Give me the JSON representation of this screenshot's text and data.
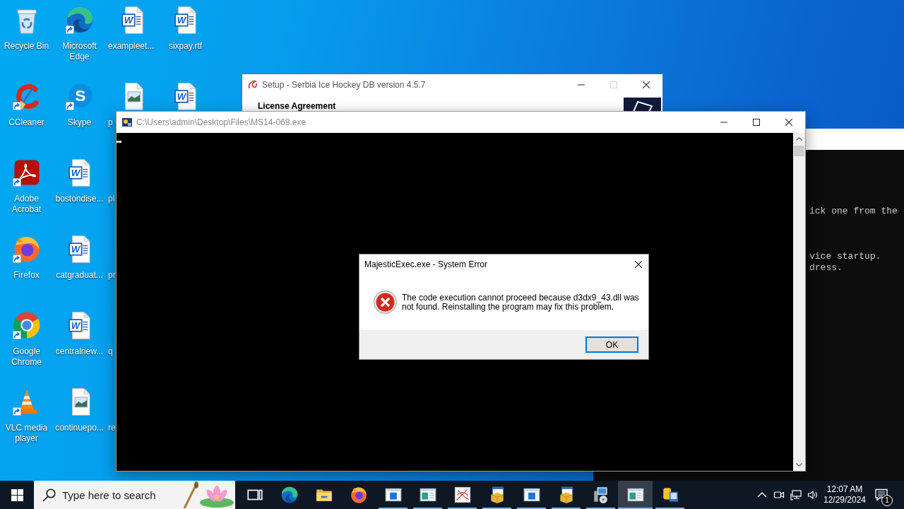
{
  "desktop": {
    "columns": [
      {
        "partly_hidden": false,
        "icons": [
          {
            "label": "Recycle Bin",
            "kind": "recycle-bin",
            "shortcut": false
          },
          {
            "label": "CCleaner",
            "kind": "ccleaner",
            "shortcut": true
          },
          {
            "label": "Adobe Acrobat",
            "kind": "acrobat",
            "shortcut": true
          },
          {
            "label": "Firefox",
            "kind": "firefox",
            "shortcut": true
          },
          {
            "label": "Google Chrome",
            "kind": "chrome",
            "shortcut": true
          },
          {
            "label": "VLC media player",
            "kind": "vlc",
            "shortcut": true
          }
        ]
      },
      {
        "partly_hidden": false,
        "icons": [
          {
            "label": "Microsoft Edge",
            "kind": "edge",
            "shortcut": true
          },
          {
            "label": "Skype",
            "kind": "skype",
            "glyph": "S",
            "shortcut": true
          },
          {
            "label": "bostondise...",
            "kind": "word",
            "glyph": "W",
            "shortcut": false
          },
          {
            "label": "catgraduat...",
            "kind": "word",
            "glyph": "W",
            "shortcut": false
          },
          {
            "label": "centralnew...",
            "kind": "word",
            "glyph": "W",
            "shortcut": false
          },
          {
            "label": "continuepo...",
            "kind": "image",
            "shortcut": false
          }
        ]
      },
      {
        "partly_hidden": true,
        "icons": [
          {
            "label": "exampleet...",
            "kind": "word",
            "glyph": "W",
            "shortcut": false
          },
          {
            "label": "p",
            "kind": "image",
            "shortcut": false
          },
          {
            "label": "pl",
            "kind": "none"
          },
          {
            "label": "pr",
            "kind": "none"
          },
          {
            "label": "q",
            "kind": "none"
          },
          {
            "label": "re",
            "kind": "none"
          }
        ]
      },
      {
        "partly_hidden": false,
        "icons": [
          {
            "label": "sixpay.rtf",
            "kind": "word",
            "glyph": "W",
            "shortcut": false
          },
          {
            "kind": "word",
            "glyph": "W",
            "shortcut": false
          }
        ]
      }
    ]
  },
  "setup_window": {
    "title": "Setup - Serbia Ice Hockey DB version 4.5.7",
    "heading": "License Agreement",
    "controls": [
      {
        "kind": "minimize",
        "disabled": false
      },
      {
        "kind": "maximize",
        "disabled": true
      },
      {
        "kind": "close",
        "disabled": false
      }
    ]
  },
  "console_window": {
    "title": "C:\\Users\\admin\\Desktop\\Files\\MS14-068.exe",
    "controls": [
      {
        "kind": "minimize",
        "disabled": false
      },
      {
        "kind": "maximize",
        "disabled": false
      },
      {
        "kind": "close",
        "disabled": false
      }
    ]
  },
  "background_console": {
    "paragraphs": [
      {
        "lines": [
          "ick one from the"
        ]
      },
      {
        "lines": [
          "vice startup.",
          "dress."
        ]
      }
    ]
  },
  "error_dialog": {
    "title": "MajesticExec.exe - System Error",
    "message": "The code execution cannot proceed because d3dx9_43.dll was not found. Reinstalling the program may fix this problem.",
    "buttons": [
      {
        "label": "OK",
        "default": true
      }
    ]
  },
  "taskbar": {
    "search": {
      "placeholder": "Type here to search"
    },
    "apps": [
      {
        "kind": "task-view",
        "running": false,
        "selected": false
      },
      {
        "kind": "edge",
        "running": false,
        "selected": false
      },
      {
        "kind": "folder",
        "running": false,
        "selected": false
      },
      {
        "kind": "firefox",
        "running": false,
        "selected": false
      },
      {
        "kind": "app-window",
        "running": true,
        "selected": false
      },
      {
        "kind": "image-window",
        "running": true,
        "selected": false
      },
      {
        "kind": "sketch",
        "running": true,
        "selected": false
      },
      {
        "kind": "installer",
        "running": true,
        "selected": false
      },
      {
        "kind": "app-window",
        "running": true,
        "selected": false
      },
      {
        "kind": "installer",
        "running": true,
        "selected": false
      },
      {
        "kind": "computer-disc",
        "running": true,
        "selected": false
      },
      {
        "kind": "image-window",
        "running": true,
        "selected": true
      },
      {
        "kind": "script",
        "running": true,
        "selected": false
      }
    ],
    "clock": {
      "time": "12:07 AM",
      "date": "12/29/2024"
    },
    "notifications": {
      "count": "1"
    }
  }
}
